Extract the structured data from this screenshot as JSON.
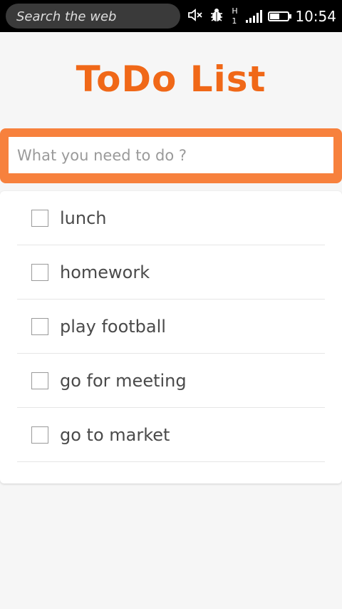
{
  "statusbar": {
    "search_text": "Search the web",
    "network_type": "H",
    "network_sim": "1",
    "time": "10:54",
    "battery_level": 0.55,
    "icons": [
      "mute-icon",
      "bug-icon",
      "signal-icon",
      "battery-icon"
    ]
  },
  "app": {
    "title": "ToDo List",
    "accent_color": "#f06818",
    "input_border_color": "#f7813d"
  },
  "input": {
    "placeholder": "What you need to do ?",
    "value": ""
  },
  "todos": [
    {
      "label": "lunch",
      "checked": false
    },
    {
      "label": "homework",
      "checked": false
    },
    {
      "label": "play football",
      "checked": false
    },
    {
      "label": "go for meeting",
      "checked": false
    },
    {
      "label": "go to market",
      "checked": false
    }
  ]
}
